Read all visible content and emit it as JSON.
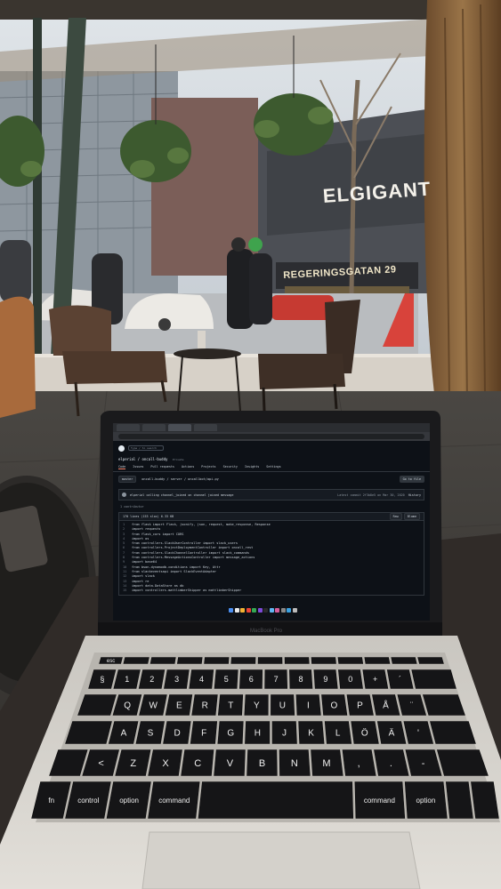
{
  "signs": {
    "store": "ELGIGANT",
    "street": "REGERINGSGATAN 29"
  },
  "laptop": {
    "brand": "MacBook Pro",
    "screen": {
      "repo": "elperial / oncall-buddy",
      "repo_visibility": "Private",
      "search_placeholder": "Type / to search",
      "nav_tabs": [
        "Code",
        "Issues",
        "Pull requests",
        "Actions",
        "Projects",
        "Security",
        "Insights",
        "Settings"
      ],
      "branch": "master",
      "path": "oncall-buddy / server / oncallbot/api.py",
      "go_to_file": "Go to file",
      "commit_message": "elperial calling channel_joined on channel joined message",
      "commit_info": "Latest commit 2f3b8e5 on Mar 30, 2020",
      "history": "History",
      "contributors": "1 contributor",
      "file_info": "170 lines (153 sloc) 6.33 KB",
      "raw": "Raw",
      "blame": "Blame",
      "code_lines": [
        "from flask import Flask, jsonify, json, request, make_response, Response",
        "import requests",
        "from flask_cors import CORS",
        "import os",
        "from controllers.SlackUserController import slack_users",
        "from controllers.ProjectDeploymentController import oncall_rest",
        "from controllers.SlackChannelController import slack_commands",
        "from controllers.MessageActionsController import message_actions",
        "import base64",
        "from bson.dynamodb.conditions import Key, Attr",
        "from slackeventsapi import SlackEventAdapter",
        "import slack",
        "import re",
        "import data.DataStore as db",
        "import controllers.mattlimberShipper as mattlimberShipper"
      ]
    }
  },
  "keyboard": {
    "esc": "esc",
    "numbers": [
      "§",
      "1",
      "2",
      "3",
      "4",
      "5",
      "6",
      "7",
      "8",
      "9",
      "0",
      "+",
      "´"
    ],
    "row_q": [
      "Q",
      "W",
      "E",
      "R",
      "T",
      "Y",
      "U",
      "I",
      "O",
      "P",
      "Å",
      "¨"
    ],
    "row_a": [
      "A",
      "S",
      "D",
      "F",
      "G",
      "H",
      "J",
      "K",
      "L",
      "Ö",
      "Ä",
      "'"
    ],
    "row_z": [
      "<",
      "Z",
      "X",
      "C",
      "V",
      "B",
      "N",
      "M",
      ",",
      ".",
      "-"
    ],
    "fn": "fn",
    "control": "control",
    "option": "option",
    "command": "command",
    "command_right": "command",
    "option_right": "option"
  }
}
